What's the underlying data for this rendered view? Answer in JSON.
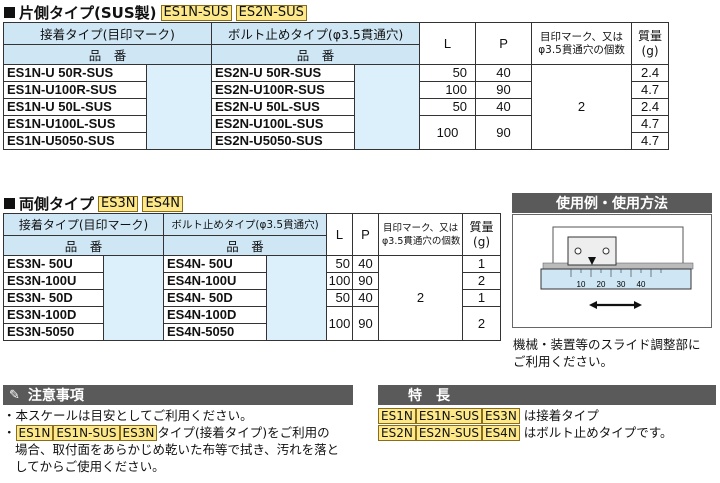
{
  "s1": {
    "title": "片側タイプ(SUS製)",
    "tags": [
      "ES1N-SUS",
      "ES2N-SUS"
    ],
    "headers": {
      "adhesive": "接着タイプ(目印マーク)",
      "bolt": "ボルト止めタイプ(φ3.5貫通穴)",
      "part": "品　番",
      "l": "L",
      "p": "P",
      "marks_line1": "目印マーク、又は",
      "marks_line2": "φ3.5貫通穴の個数",
      "mass_line1": "質量",
      "mass_line2": "(g)"
    },
    "rows": [
      {
        "a": "ES1N-U  50R-SUS",
        "b": "ES2N-U  50R-SUS",
        "l": "50",
        "p": "40",
        "g": "2.4"
      },
      {
        "a": "ES1N-U100R-SUS",
        "b": "ES2N-U100R-SUS",
        "l": "100",
        "p": "90",
        "g": "4.7"
      },
      {
        "a": "ES1N-U  50L-SUS",
        "b": "ES2N-U  50L-SUS",
        "l": "50",
        "p": "40",
        "g": "2.4"
      },
      {
        "a": "ES1N-U100L-SUS",
        "b": "ES2N-U100L-SUS",
        "l": "100",
        "p": "90",
        "g": "4.7"
      },
      {
        "a": "ES1N-U5050-SUS",
        "b": "ES2N-U5050-SUS",
        "l": "",
        "p": "",
        "g": "4.7"
      }
    ],
    "marks": "2"
  },
  "s2": {
    "title": "両側タイプ",
    "tags": [
      "ES3N",
      "ES4N"
    ],
    "headers": {
      "adhesive": "接着タイプ(目印マーク)",
      "bolt": "ボルト止めタイプ(φ3.5貫通穴)",
      "part": "品　番",
      "l": "L",
      "p": "P",
      "marks_line1": "目印マーク、又は",
      "marks_line2": "φ3.5貫通穴の個数",
      "mass_line1": "質量",
      "mass_line2": "(g)"
    },
    "rows": [
      {
        "a": "ES3N-  50U",
        "b": "ES4N-  50U",
        "l": "50",
        "p": "40",
        "g": "1"
      },
      {
        "a": "ES3N-100U",
        "b": "ES4N-100U",
        "l": "100",
        "p": "90",
        "g": "2"
      },
      {
        "a": "ES3N-  50D",
        "b": "ES4N-  50D",
        "l": "50",
        "p": "40",
        "g": "1"
      },
      {
        "a": "ES3N-100D",
        "b": "ES4N-100D",
        "l": "100",
        "p": "90",
        "g": "2"
      },
      {
        "a": "ES3N-5050",
        "b": "ES4N-5050",
        "l": "",
        "p": "",
        "g": ""
      }
    ],
    "marks": "2"
  },
  "usage": {
    "title": "使用例・使用方法",
    "scale_ticks": [
      "10",
      "20",
      "30",
      "40"
    ],
    "caption_line1": "機械・装置等のスライド調整部に",
    "caption_line2": "ご利用ください。"
  },
  "caution": {
    "title": "注意事項",
    "line1": "・本スケールは目安としてご利用ください。",
    "tags": [
      "ES1N",
      "ES1N-SUS",
      "ES3N"
    ],
    "line2_suffix": "タイプ(接着タイプ)をご利用の",
    "line3": "場合、取付面をあらかじめ乾いた布等で拭き、汚れを落と",
    "line4": "してからご使用ください。"
  },
  "features": {
    "title": "特　長",
    "row1_tags": [
      "ES1N",
      "ES1N-SUS",
      "ES3N"
    ],
    "row1_text": "は接着タイプ",
    "row2_tags": [
      "ES2N",
      "ES2N-SUS",
      "ES4N"
    ],
    "row2_text": "はボルト止めタイプです。"
  }
}
